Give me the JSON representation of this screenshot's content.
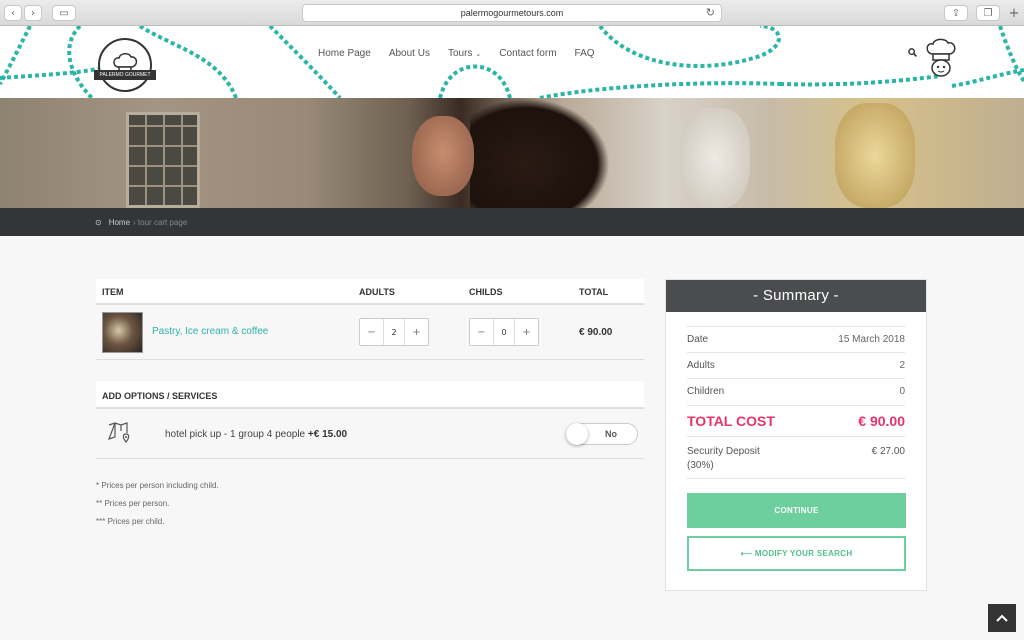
{
  "browser": {
    "url": "palermogourmetours.com"
  },
  "header": {
    "nav": [
      "Home Page",
      "About Us",
      "Tours",
      "Contact form",
      "FAQ"
    ],
    "logo_text": "PALERMO GOURMET TOURS",
    "accent": "#2bb5a7"
  },
  "breadcrumb": {
    "home": "Home",
    "current": "› tour cart page"
  },
  "cart": {
    "headers": {
      "item": "ITEM",
      "adults": "ADULTS",
      "childs": "CHILDS",
      "total": "TOTAL"
    },
    "item": {
      "name": "Pastry, Ice cream & coffee",
      "adults": "2",
      "childs": "0",
      "total": "€ 90.00"
    },
    "options_title": "ADD OPTIONS / SERVICES",
    "option": {
      "text": "hotel pick up - 1 group 4 people",
      "price": "+€ 15.00",
      "toggle": "No"
    },
    "notes": [
      "* Prices per person including child.",
      "** Prices per person.",
      "*** Prices per child."
    ]
  },
  "summary": {
    "title": "- Summary -",
    "rows": [
      {
        "label": "Date",
        "value": "15 March 2018"
      },
      {
        "label": "Adults",
        "value": "2"
      },
      {
        "label": "Children",
        "value": "0"
      }
    ],
    "total_label": "TOTAL COST",
    "total_value": "€ 90.00",
    "deposit_label": "Security Deposit (30%)",
    "deposit_value": "€ 27.00",
    "continue": "CONTINUE",
    "modify": "⟵ MODIFY YOUR SEARCH",
    "colors": {
      "button": "#6ccf9d",
      "total": "#e6336b"
    }
  }
}
